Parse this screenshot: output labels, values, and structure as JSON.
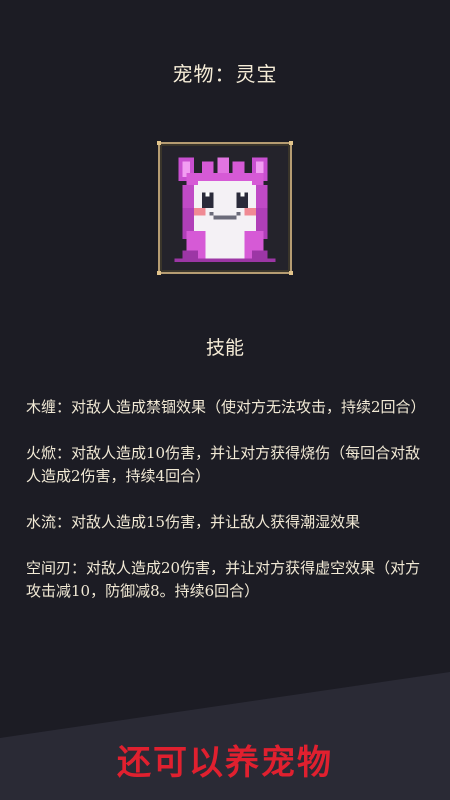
{
  "pet": {
    "title": "宠物：灵宝",
    "portrait_icon": "pink-bunny-pet-icon"
  },
  "skills": {
    "heading": "技能",
    "items": [
      {
        "text": "木缠：对敌人造成禁锢效果（使对方无法攻击，持续2回合）"
      },
      {
        "text": "火焮：对敌人造成10伤害，并让对方获得烧伤（每回合对敌人造成2伤害，持续4回合）"
      },
      {
        "text": "水流：对敌人造成15伤害，并让敌人获得潮湿效果"
      },
      {
        "text": "空间刃：对敌人造成20伤害，并让对方获得虚空效果（对方攻击减10，防御减8。持续6回合）"
      }
    ]
  },
  "promo": {
    "text": "还可以养宠物"
  },
  "colors": {
    "background": "#1c1c24",
    "text": "#f3ead8",
    "frame": "#b59c72",
    "promo": "#e0202f",
    "pet_pink": "#d65ad6"
  }
}
